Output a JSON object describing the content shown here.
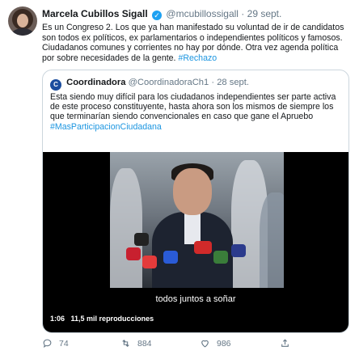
{
  "tweet": {
    "author_name": "Marcela Cubillos Sigall",
    "handle": "@mcubillossigall",
    "separator": "·",
    "date": "29 sept.",
    "text": "Es un Congreso 2. Los que ya han manifestado su voluntad de ir de candidatos son todos ex políticos, ex parlamentarios o independientes políticos y famosos. Ciudadanos comunes y corrientes no hay por dónde. Otra vez agenda política por sobre necesidades de la gente.",
    "hashtag": "#Rechazo"
  },
  "quoted": {
    "author_name": "Coordinadora",
    "handle": "@CoordinadoraCh1",
    "separator": "·",
    "date": "28 sept.",
    "text": "Esta siendo muy difícil para los ciudadanos independientes ser parte activa de este proceso constituyente, hasta ahora son los mismos de siempre los que terminarían siendo convencionales en caso que gane el Apruebo",
    "hashtag": "#MasParticipacionCiudadana",
    "video": {
      "subtitle": "todos juntos a soñar",
      "duration": "1:06",
      "views": "11,5 mil reproducciones"
    }
  },
  "actions": {
    "replies": "74",
    "retweets": "884",
    "likes": "986"
  },
  "colors": {
    "link": "#1b95e0",
    "verified": "#1da1f2",
    "muted": "#657786"
  }
}
